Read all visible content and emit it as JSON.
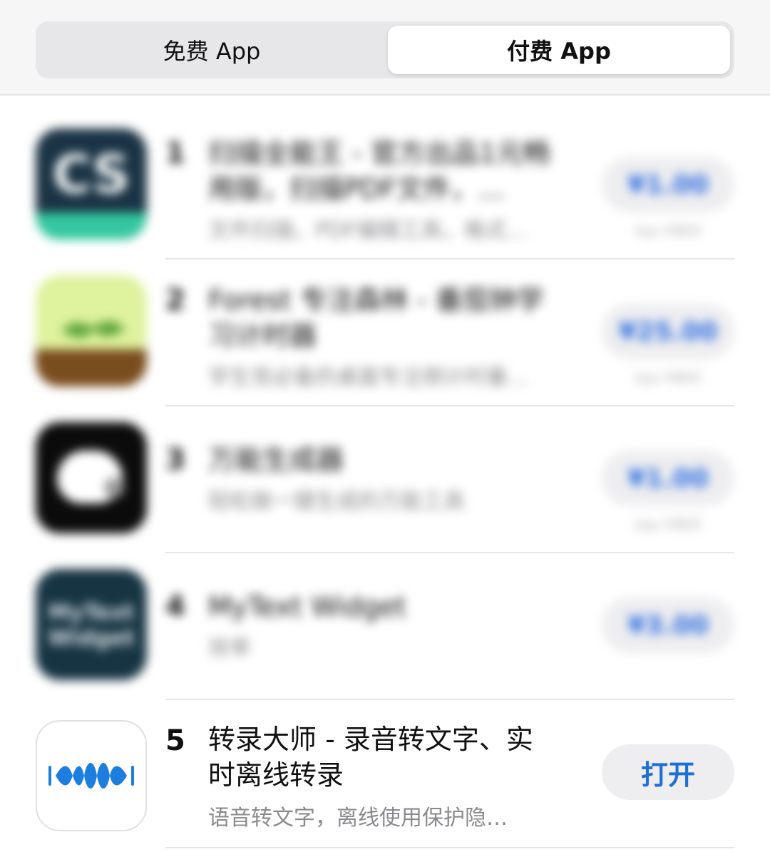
{
  "segmented": {
    "free_label": "免费 App",
    "paid_label": "付费 App",
    "selected": "paid"
  },
  "apps": [
    {
      "rank": "1",
      "name": "扫描全能王 - 官方出品1元畅用版，扫描PDF文件，…",
      "subtitle": "文件扫描，PDF编辑工具，格式…",
      "price": "¥1.00",
      "iap": "App 内购买",
      "icon": "cs-scanner-icon",
      "blurred": true
    },
    {
      "rank": "2",
      "name": "Forest 专注森林 - 番茄钟学习计时器",
      "subtitle": "学生党必备的桌面专注倒计时番…",
      "price": "¥25.00",
      "iap": "App 内购买",
      "icon": "forest-sprout-icon",
      "blurred": true
    },
    {
      "rank": "3",
      "name": "万能生成器",
      "subtitle": "轻松做一键生成的万能工具",
      "price": "¥1.00",
      "iap": "App 内购买",
      "icon": "generator-icon",
      "blurred": true
    },
    {
      "rank": "4",
      "name": "MyText Widget",
      "subtitle": "效率",
      "price": "¥3.00",
      "icon": "mytext-widget-icon",
      "blurred": true
    },
    {
      "rank": "5",
      "name": "转录大师 - 录音转文字、实时离线转录",
      "subtitle": "语音转文字，离线使用保护隐…",
      "action": "打开",
      "icon": "sound-wave-icon",
      "blurred": false
    }
  ],
  "colors": {
    "accent": "#1f6fd8",
    "header_bg": "#f6f6f7",
    "button_bg": "#eeeef0"
  }
}
